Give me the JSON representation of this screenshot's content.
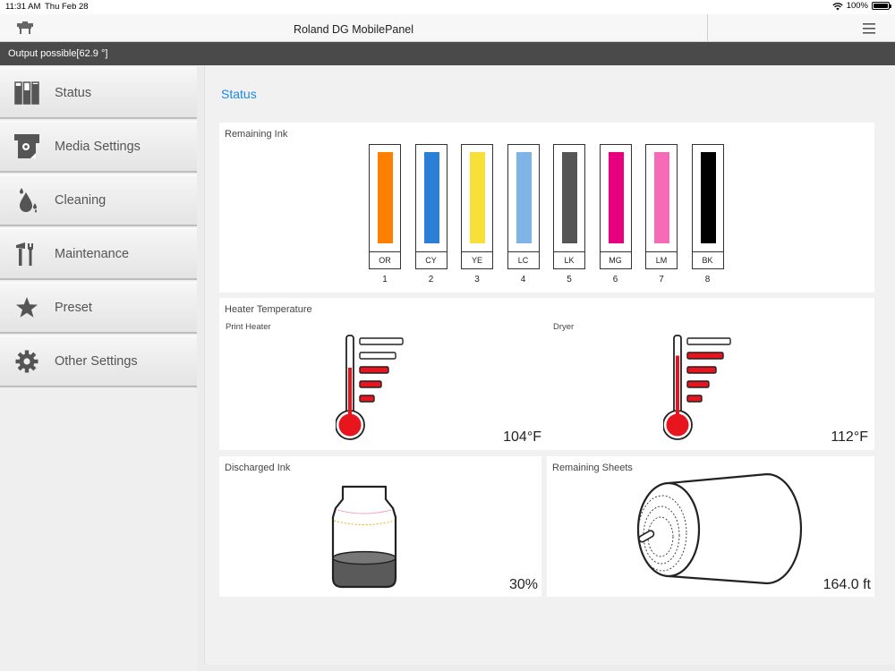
{
  "statusbar": {
    "time": "11:31 AM",
    "date": "Thu Feb 28",
    "battery": "100%"
  },
  "navbar": {
    "title": "Roland DG MobilePanel"
  },
  "status_strip": {
    "text": "Output possible[62.9 °]"
  },
  "sidebar": {
    "items": [
      {
        "label": "Status",
        "icon": "status-bars-icon"
      },
      {
        "label": "Media Settings",
        "icon": "media-settings-icon"
      },
      {
        "label": "Cleaning",
        "icon": "cleaning-drops-icon"
      },
      {
        "label": "Maintenance",
        "icon": "maintenance-tools-icon"
      },
      {
        "label": "Preset",
        "icon": "star-icon"
      },
      {
        "label": "Other Settings",
        "icon": "gear-icon"
      }
    ]
  },
  "main": {
    "title": "Status",
    "remaining_ink": {
      "title": "Remaining Ink",
      "inks": [
        {
          "code": "OR",
          "num": "1",
          "color": "#ff8000",
          "level": 0.93
        },
        {
          "code": "CY",
          "num": "2",
          "color": "#2b7fd6",
          "level": 0.93
        },
        {
          "code": "YE",
          "num": "3",
          "color": "#f8e03a",
          "level": 0.93
        },
        {
          "code": "LC",
          "num": "4",
          "color": "#7fb5e6",
          "level": 0.93
        },
        {
          "code": "LK",
          "num": "5",
          "color": "#555555",
          "level": 0.93
        },
        {
          "code": "MG",
          "num": "6",
          "color": "#e6007e",
          "level": 0.93
        },
        {
          "code": "LM",
          "num": "7",
          "color": "#f56bb7",
          "level": 0.93
        },
        {
          "code": "BK",
          "num": "8",
          "color": "#000000",
          "level": 0.93
        }
      ]
    },
    "heater": {
      "title": "Heater Temperature",
      "print_heater": {
        "label": "Print Heater",
        "value": "104°F",
        "level": 0.6,
        "bars_on": 3
      },
      "dryer": {
        "label": "Dryer",
        "value": "112°F",
        "level": 0.75,
        "bars_on": 4
      }
    },
    "discharged_ink": {
      "title": "Discharged Ink",
      "value": "30%",
      "level": 0.3
    },
    "remaining_sheets": {
      "title": "Remaining Sheets",
      "value": "164.0 ft"
    }
  }
}
